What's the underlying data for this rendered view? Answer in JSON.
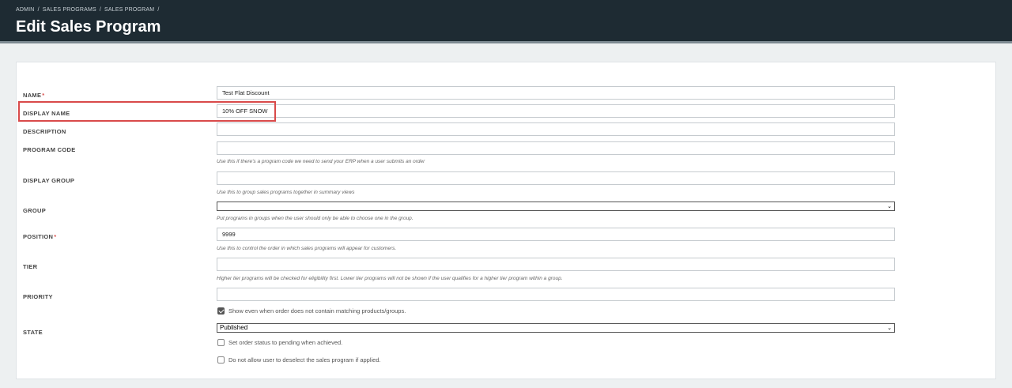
{
  "breadcrumb": [
    "ADMIN",
    "SALES PROGRAMS",
    "SALES PROGRAM"
  ],
  "page_title": "Edit Sales Program",
  "fields": {
    "name": {
      "label": "NAME",
      "required": "*",
      "value": "Test Flat Discount"
    },
    "display_name": {
      "label": "DISPLAY NAME",
      "value": "10% OFF SNOW"
    },
    "description": {
      "label": "DESCRIPTION",
      "value": ""
    },
    "program_code": {
      "label": "PROGRAM CODE",
      "value": "",
      "help": "Use this if there's a program code we need to send your ERP when a user submits an order"
    },
    "display_group": {
      "label": "DISPLAY GROUP",
      "value": "",
      "help": "Use this to group sales programs together in summary views"
    },
    "group": {
      "label": "GROUP",
      "value": "",
      "help": "Put programs in groups when the user should only be able to choose one in the group."
    },
    "position": {
      "label": "POSITION",
      "required": "*",
      "value": "9999",
      "help": "Use this to control the order in which sales programs will appear for customers."
    },
    "tier": {
      "label": "TIER",
      "value": "",
      "help": "Higher tier programs will be checked for eligibility first. Lower tier programs will not be shown if the user qualifies for a higher tier program within a group."
    },
    "priority": {
      "label": "PRIORITY",
      "value": ""
    },
    "show_even": {
      "label": "Show even when order does not contain matching products/groups.",
      "checked": true
    },
    "state": {
      "label": "STATE",
      "value": "Published"
    },
    "set_pending": {
      "label": "Set order status to pending when achieved.",
      "checked": false
    },
    "no_deselect": {
      "label": "Do not allow user to deselect the sales program if applied.",
      "checked": false
    }
  },
  "colors": {
    "header_bg": "#1e2b33",
    "highlight": "#d94a4a"
  }
}
